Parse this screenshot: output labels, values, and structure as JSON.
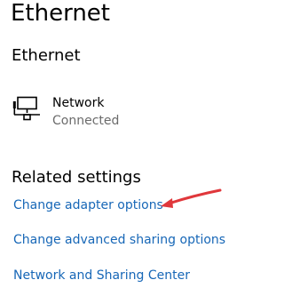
{
  "page": {
    "title": "Ethernet"
  },
  "section": {
    "title": "Ethernet"
  },
  "network": {
    "name": "Network",
    "status": "Connected",
    "icon": "network-icon"
  },
  "related": {
    "title": "Related settings",
    "links": [
      "Change adapter options",
      "Change advanced sharing options",
      "Network and Sharing Center"
    ]
  },
  "colors": {
    "link": "#1767b7",
    "secondary_text": "#6b6b6b",
    "annotation_arrow": "#e0373b"
  }
}
